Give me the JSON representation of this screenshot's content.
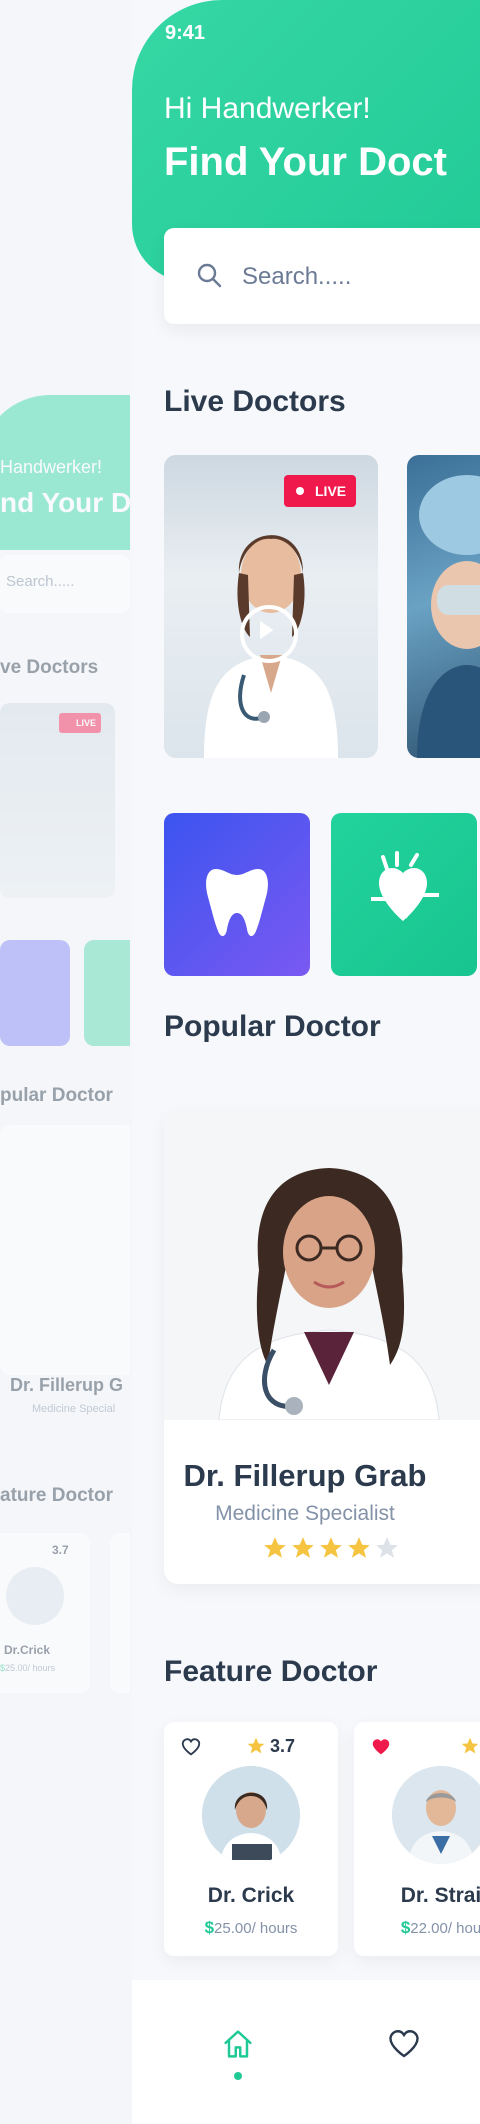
{
  "status": {
    "time": "9:41"
  },
  "header": {
    "greeting": "Hi Handwerker!",
    "headline": "Find Your Doct"
  },
  "search": {
    "placeholder": "Search....."
  },
  "live": {
    "title": "Live Doctors",
    "badge": "LIVE"
  },
  "popular": {
    "title": "Popular Doctor",
    "doctor": {
      "name": "Dr. Fillerup Grab",
      "specialty": "Medicine Specialist",
      "rating_stars": 4,
      "max_stars": 5
    }
  },
  "feature": {
    "title": "Feature Doctor",
    "cards": [
      {
        "name": "Dr. Crick",
        "price": "25.00/ hours",
        "currency": "$",
        "rating": "3.7",
        "favorited": false
      },
      {
        "name": "Dr. Strai",
        "price": "22.00/ hou",
        "currency": "$",
        "rating": "",
        "favorited": true
      }
    ]
  },
  "background_screen": {
    "greeting": "Handwerker!",
    "headline": "nd Your D",
    "search": "Search.....",
    "live_title": "ve Doctors",
    "badge": "LIVE",
    "popular_title": "pular Doctor",
    "doctor_name": "Dr. Fillerup G",
    "doctor_spec": "Medicine Special",
    "feature_title": "ature Doctor",
    "feature_rating": "3.7",
    "feature_name": "Dr.Crick",
    "feature_price": "25.00/ hours",
    "feature_currency": "$"
  },
  "colors": {
    "accent": "#1fc995",
    "live": "#f0194c",
    "tooth_tile": "#4a55f0",
    "heart_tile": "#22c995",
    "star": "#f5c542"
  },
  "icons": [
    "search-icon",
    "play-icon",
    "tooth-icon",
    "heart-pulse-icon",
    "star-icon",
    "heart-outline-icon",
    "heart-filled-icon",
    "home-icon"
  ]
}
